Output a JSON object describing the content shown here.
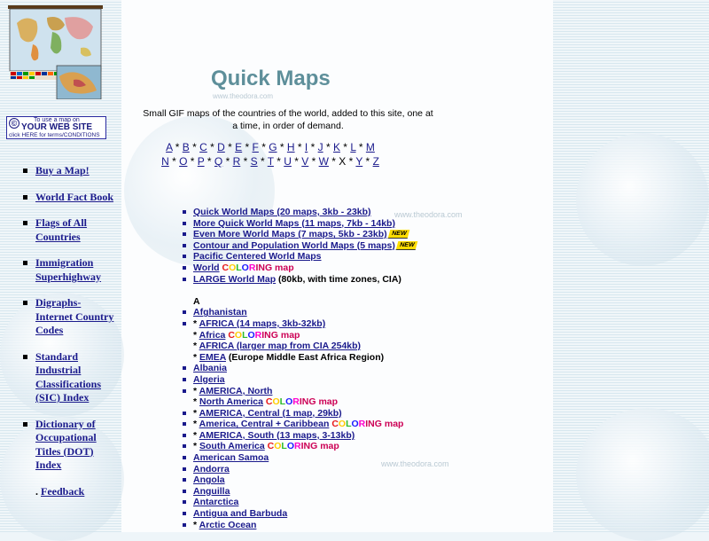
{
  "page": {
    "title": "Quick Maps",
    "title_watermark": "www.theodora.com",
    "intro": "Small GIF maps of the countries of the world, added to this site, one at a time, in order of demand."
  },
  "watermarks": [
    "www.theodora.com",
    "www.theodora.com"
  ],
  "banner": {
    "copyright_symbol": "©",
    "line1": "To use a map on",
    "line2": "YOUR WEB SITE",
    "line3": "click HERE for terms/CONDITIONS"
  },
  "sidebar": {
    "items": [
      {
        "label": "Buy a Map!"
      },
      {
        "label": "World Fact Book"
      },
      {
        "label": "Flags of All Countries"
      },
      {
        "label": "Immigration Superhighway"
      },
      {
        "label": "Digraphs- Internet Country Codes"
      },
      {
        "label": "Standard Industrial Classifications (SIC) Index"
      },
      {
        "label": "Dictionary of Occupational Titles (DOT) Index"
      }
    ],
    "feedback": {
      "dot": ".",
      "label": "Feedback"
    }
  },
  "alphabet": {
    "row1": [
      "A",
      "B",
      "C",
      "D",
      "E",
      "F",
      "G",
      "H",
      "I",
      "J",
      "K",
      "L",
      "M"
    ],
    "row2": [
      "N",
      "O",
      "P",
      "Q",
      "R",
      "S",
      "T",
      "U",
      "V",
      "W",
      "X",
      "Y",
      "Z"
    ],
    "unlinked": [
      "X"
    ],
    "separator": "*"
  },
  "coloring": {
    "letters": [
      "C",
      "O",
      "L",
      "O",
      "R",
      "ING"
    ],
    "suffix": "map"
  },
  "new_badge": "NEW",
  "list": {
    "top": [
      {
        "link": "Quick World Maps (20 maps, 3kb - 23kb)"
      },
      {
        "link": "More Quick World Maps (11 maps, 7kb - 14kb)"
      },
      {
        "link": "Even More World Maps (7 maps, 5kb - 23kb)",
        "new": true
      },
      {
        "link": "Contour and Population World Maps (5 maps)",
        "new": true
      },
      {
        "link": "Pacific Centered World Maps"
      },
      {
        "link": "World",
        "coloring": true
      },
      {
        "link": "LARGE World Map",
        "suffix": " (80kb, with time zones, CIA)"
      }
    ],
    "section_heading": "A",
    "entries": [
      {
        "link": "Afghanistan"
      },
      {
        "star": true,
        "link": "AFRICA (14 maps, 3kb-32kb)"
      },
      {
        "star": true,
        "link": "Africa",
        "coloring": true,
        "no_bullet": true
      },
      {
        "star": true,
        "link": "AFRICA (larger map from CIA 254kb)",
        "no_bullet": true
      },
      {
        "star": true,
        "link": "EMEA",
        "suffix": " (Europe Middle East Africa Region)",
        "no_bullet": true
      },
      {
        "link": "Albania"
      },
      {
        "link": "Algeria"
      },
      {
        "star": true,
        "link": "AMERICA, North"
      },
      {
        "star": true,
        "link": "North America",
        "coloring": true,
        "no_bullet": true
      },
      {
        "star": true,
        "link": "AMERICA, Central (1 map, 29kb)"
      },
      {
        "star": true,
        "link": "America, Central + Caribbean",
        "coloring": true
      },
      {
        "star": true,
        "link": "AMERICA, South (13 maps, 3-13kb)"
      },
      {
        "star": true,
        "link": "South America",
        "coloring": true
      },
      {
        "link": "American Samoa"
      },
      {
        "link": "Andorra"
      },
      {
        "link": "Angola"
      },
      {
        "link": "Anguilla"
      },
      {
        "link": "Antarctica"
      },
      {
        "link": "Antigua and Barbuda"
      },
      {
        "star": true,
        "link": "Arctic Ocean"
      }
    ]
  },
  "colors": {
    "link": "#1a1a8c",
    "title": "#5e8f9a",
    "badge": "#ffdd00"
  }
}
